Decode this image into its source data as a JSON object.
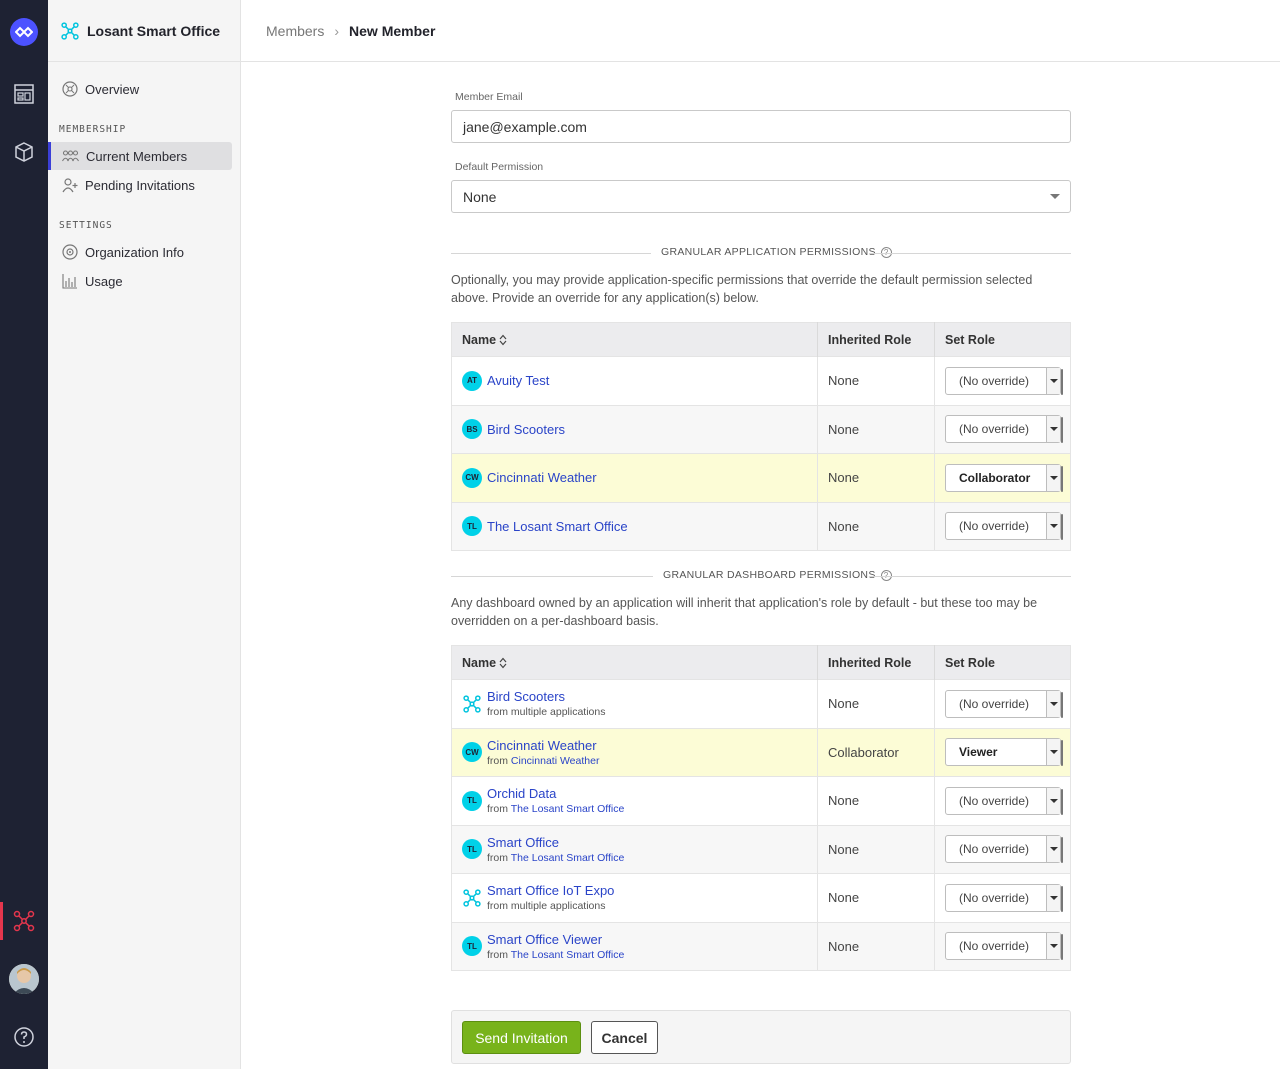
{
  "sidebar": {
    "org_name": "Losant Smart Office",
    "overview": "Overview",
    "membership_heading": "MEMBERSHIP",
    "current_members": "Current Members",
    "pending_invitations": "Pending Invitations",
    "settings_heading": "SETTINGS",
    "org_info": "Organization Info",
    "usage": "Usage"
  },
  "breadcrumb": {
    "parent": "Members",
    "separator": "›",
    "current": "New Member"
  },
  "form": {
    "email_label": "Member Email",
    "email_value": "jane@example.com",
    "default_perm_label": "Default Permission",
    "default_perm_value": "None"
  },
  "app_perms": {
    "heading": "GRANULAR APPLICATION PERMISSIONS",
    "description": "Optionally, you may provide application-specific permissions that override the default permission selected above. Provide an override for any application(s) below.",
    "col_name": "Name",
    "col_inherited": "Inherited Role",
    "col_set": "Set Role",
    "rows": [
      {
        "badge": "AT",
        "name": "Avuity Test",
        "inherited": "None",
        "role": "(No override)"
      },
      {
        "badge": "BS",
        "name": "Bird Scooters",
        "inherited": "None",
        "role": "(No override)"
      },
      {
        "badge": "CW",
        "name": "Cincinnati Weather",
        "inherited": "None",
        "role": "Collaborator"
      },
      {
        "badge": "TL",
        "name": "The Losant Smart Office",
        "inherited": "None",
        "role": "(No override)"
      }
    ]
  },
  "dash_perms": {
    "heading": "GRANULAR DASHBOARD PERMISSIONS",
    "description": "Any dashboard owned by an application will inherit that application's role by default - but these too may be overridden on a per-dashboard basis.",
    "col_name": "Name",
    "col_inherited": "Inherited Role",
    "col_set": "Set Role",
    "rows": [
      {
        "badge": "",
        "name": "Bird Scooters",
        "from_prefix": "from multiple applications",
        "from_link": "",
        "inherited": "None",
        "role": "(No override)"
      },
      {
        "badge": "CW",
        "name": "Cincinnati Weather",
        "from_prefix": "from",
        "from_link": "Cincinnati Weather",
        "inherited": "Collaborator",
        "role": "Viewer"
      },
      {
        "badge": "TL",
        "name": "Orchid Data",
        "from_prefix": "from",
        "from_link": "The Losant Smart Office",
        "inherited": "None",
        "role": "(No override)"
      },
      {
        "badge": "TL",
        "name": "Smart Office",
        "from_prefix": "from",
        "from_link": "The Losant Smart Office",
        "inherited": "None",
        "role": "(No override)"
      },
      {
        "badge": "",
        "name": "Smart Office IoT Expo",
        "from_prefix": "from multiple applications",
        "from_link": "",
        "inherited": "None",
        "role": "(No override)"
      },
      {
        "badge": "TL",
        "name": "Smart Office Viewer",
        "from_prefix": "from",
        "from_link": "The Losant Smart Office",
        "inherited": "None",
        "role": "(No override)"
      }
    ]
  },
  "actions": {
    "send": "Send Invitation",
    "cancel": "Cancel"
  },
  "colors": {
    "accent": "#3b3fd8",
    "link": "#2a44c8",
    "primary_button": "#78b31b",
    "badge": "#00d1e8",
    "highlight_row": "#fcfcd6",
    "rail": "#1e2233"
  }
}
